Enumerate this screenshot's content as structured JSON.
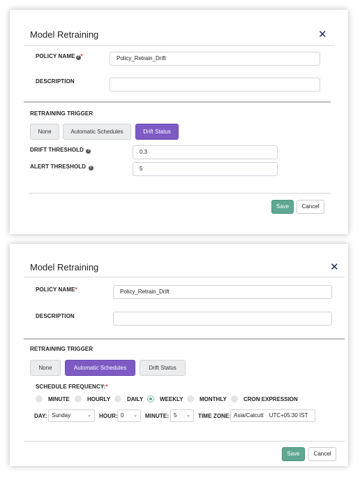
{
  "dialogs": [
    {
      "title": "Model Retraining",
      "policy_name_label": "POLICY NAME",
      "policy_name_required": "*",
      "policy_name_value": "Policy_Retrain_Drift",
      "description_label": "DESCRIPTION",
      "description_value": "",
      "trigger_label": "RETRAINING TRIGGER",
      "trigger_buttons": [
        "None",
        "Automatic Schedules",
        "Drift Status"
      ],
      "active_trigger": "Drift Status",
      "drift_threshold_label": "DRIFT THRESHOLD",
      "drift_threshold_value": "0.3",
      "alert_threshold_label": "ALERT THRESHOLD",
      "alert_threshold_value": "5",
      "save_label": "Save",
      "cancel_label": "Cancel"
    },
    {
      "title": "Model Retraining",
      "policy_name_label": "POLICY NAME",
      "policy_name_required": "*",
      "policy_name_value": "Policy_Retrain_Drift",
      "description_label": "DESCRIPTION",
      "description_value": "",
      "trigger_label": "RETRAINING TRIGGER",
      "trigger_buttons": [
        "None",
        "Automatic Schedules",
        "Drift Status"
      ],
      "active_trigger": "Automatic Schedules",
      "schedule_frequency_label": "SCHEDULE FREQUENCY:",
      "schedule_frequency_required": "*",
      "frequency_options": [
        "MINUTE",
        "HOURLY",
        "DAILY",
        "WEEKLY",
        "MONTHLY",
        "CRON EXPRESSION"
      ],
      "selected_frequency": "WEEKLY",
      "day_label": "DAY:",
      "day_value": "Sunday",
      "hour_label": "HOUR:",
      "hour_value": "0",
      "minute_label": "MINUTE:",
      "minute_value": "5",
      "timezone_label": "TIME ZONE:",
      "timezone_value": "Asia/Calcutt",
      "timezone_offset": "UTC+05:30 IST",
      "save_label": "Save",
      "cancel_label": "Cancel"
    }
  ],
  "icons": {
    "close": "close-icon",
    "help": "help-circle-icon",
    "dropdown": "chevron-down-icon"
  },
  "colors": {
    "accent_purple": "#7e5bc4",
    "save_green": "#5fa792",
    "required_red": "#d6343a",
    "close_navy": "#1d2a5a"
  }
}
